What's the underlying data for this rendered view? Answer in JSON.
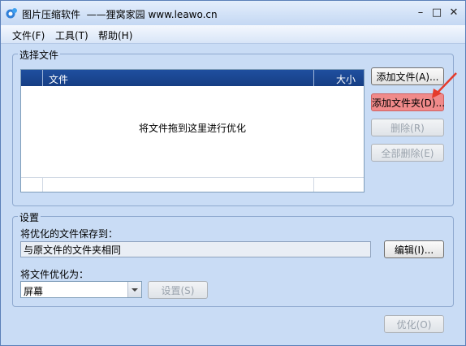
{
  "window": {
    "title": "图片压缩软件  ——狸窝家园 www.leawo.cn",
    "app_icon": "app-logo-icon",
    "controls": [
      "minimize-icon",
      "maximize-icon",
      "close-icon"
    ]
  },
  "menu": {
    "items": [
      "文件(F)",
      "工具(T)",
      "帮助(H)"
    ]
  },
  "select_files": {
    "group_label": "选择文件",
    "columns": [
      "文件",
      "大小"
    ],
    "empty_hint": "将文件拖到这里进行优化",
    "buttons": {
      "add_file": "添加文件(A)...",
      "add_folder": "添加文件夹(D)...",
      "delete": "删除(R)",
      "delete_all": "全部删除(E)"
    }
  },
  "settings": {
    "group_label": "设置",
    "save_to_label": "将优化的文件保存到：",
    "save_to_value": "与原文件的文件夹相同",
    "edit_button": "编辑(I)...",
    "optimize_for_label": "将文件优化为：",
    "optimize_for_value": "屏幕",
    "settings_button": "设置(S)"
  },
  "optimize_button": "优化(O)",
  "colors": {
    "highlight": "#f08a8a",
    "annotation_arrow": "#e53b2b",
    "list_header": "#1f4f9f"
  }
}
